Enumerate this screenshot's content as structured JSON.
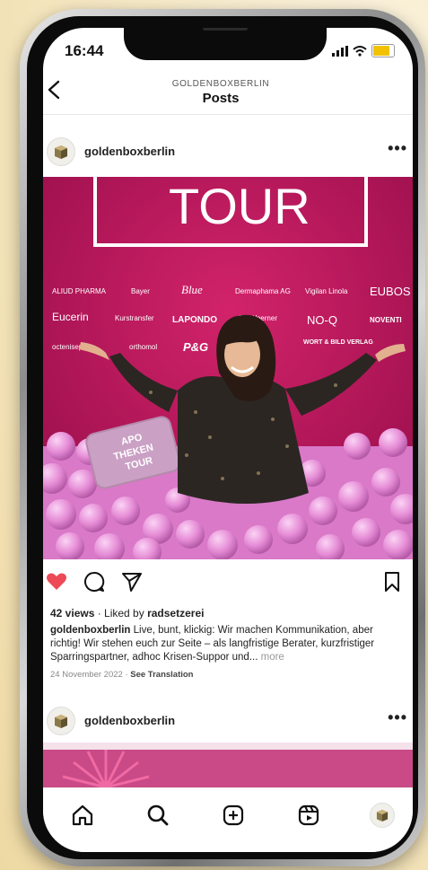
{
  "status_bar": {
    "time": "16:44"
  },
  "header": {
    "account": "GOLDENBOXBERLIN",
    "title": "Posts"
  },
  "post": {
    "username": "goldenboxberlin",
    "views_text": "42 views",
    "liked_by_prefix": " · Liked by ",
    "liked_by_user": "radsetzerei",
    "caption_user": "goldenboxberlin",
    "caption_text": " Live, bunt, klickig: Wir machen Kommunikation, aber richtig! Wir stehen euch zur Seite – als langfristige Berater, kurzfristiger Sparringspartner, adhoc Krisen-Suppor und... ",
    "more_label": "more",
    "date": "24 November 2022",
    "date_sep": " · ",
    "see_translation": "See Translation",
    "liked": true,
    "image": {
      "banner_text": "TOUR",
      "sponsors_row1": [
        "ALIUD PHARMA",
        "Bayer",
        "Blue",
        "Dermaphama AG",
        "Vigilan Linola",
        "EUBOS"
      ],
      "sponsors_row2": [
        "Eucerin",
        "Kurstransfer",
        "LAPONDO",
        "Dr. Woerner",
        "NO-Q",
        "NOVENTI"
      ],
      "sponsors_row3": [
        "octenisept",
        "orthomol",
        "P&G",
        "WORT & BILD VERLAG"
      ],
      "pillow_text_1": "APO",
      "pillow_text_2": "THEKEN",
      "pillow_text_3": "TOUR"
    }
  },
  "post2": {
    "username": "goldenboxberlin"
  },
  "icons": {
    "back": "chevron-left-icon",
    "more": "more-horizontal-icon",
    "like": "heart-icon",
    "comment": "comment-icon",
    "share": "paper-plane-icon",
    "save": "bookmark-icon",
    "home": "home-icon",
    "search": "search-icon",
    "create": "plus-square-icon",
    "reels": "reels-icon"
  },
  "colors": {
    "like_red": "#ed4956",
    "photo_magenta": "#b9165a",
    "balls_pink": "#e98ad6"
  }
}
